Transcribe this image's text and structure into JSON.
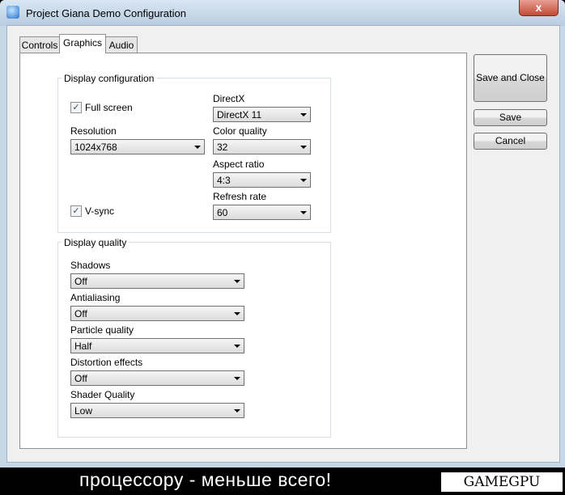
{
  "window": {
    "title": "Project Giana Demo Configuration",
    "close_glyph": "x"
  },
  "tabs": [
    {
      "label": "Controls"
    },
    {
      "label": "Graphics"
    },
    {
      "label": "Audio"
    }
  ],
  "display_config": {
    "group_label": "Display configuration",
    "fullscreen_label": "Full screen",
    "fullscreen_checked": true,
    "resolution_label": "Resolution",
    "resolution_value": "1024x768",
    "vsync_label": "V-sync",
    "vsync_checked": true,
    "directx_label": "DirectX",
    "directx_value": "DirectX 11",
    "color_label": "Color quality",
    "color_value": "32",
    "aspect_label": "Aspect ratio",
    "aspect_value": "4:3",
    "refresh_label": "Refresh rate",
    "refresh_value": "60"
  },
  "display_quality": {
    "group_label": "Display quality",
    "shadows_label": "Shadows",
    "shadows_value": "Off",
    "aa_label": "Antialiasing",
    "aa_value": "Off",
    "particle_label": "Particle quality",
    "particle_value": "Half",
    "distortion_label": "Distortion effects",
    "distortion_value": "Off",
    "shader_label": "Shader Quality",
    "shader_value": "Low"
  },
  "buttons": {
    "save_close": "Save and Close",
    "save": "Save",
    "cancel": "Cancel"
  },
  "overlay": {
    "caption": "процессору - меньше всего!",
    "logo": "GAMEGPU"
  },
  "checkmark_glyph": "✓"
}
